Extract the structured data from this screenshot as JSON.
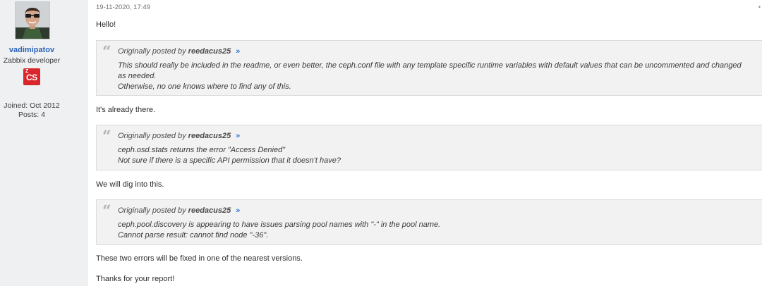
{
  "user": {
    "username": "vadimipatov",
    "title": "Zabbix developer",
    "badge_text": "CS",
    "badge_sup": "Z",
    "badge_color": "#d8262c",
    "joined": "Joined: Oct 2012",
    "posts": "Posts: 4"
  },
  "post": {
    "timestamp": "19-11-2020, 17:49",
    "greeting": "Hello!",
    "quotes": [
      {
        "prefix": "Originally posted by",
        "author": "reedacus25",
        "arrow": "»",
        "lines": [
          "This should really be included in the readme, or even better, the ceph.conf file with any template specific runtime variables with default values that can be uncommented and changed",
          "as needed.",
          "Otherwise, no one knows where to find any of this."
        ]
      },
      {
        "prefix": "Originally posted by",
        "author": "reedacus25",
        "arrow": "»",
        "lines": [
          "ceph.osd.stats returns the error \"Access Denied\"",
          "Not sure if there is a specific API permission that it doesn't have?"
        ]
      },
      {
        "prefix": "Originally posted by",
        "author": "reedacus25",
        "arrow": "»",
        "lines": [
          "ceph.pool.discovery is appearing to have issues parsing pool names with \"-\" in the pool name.",
          "Cannot parse result: cannot find node \"-36\"."
        ]
      }
    ],
    "replies": [
      "It's already there.",
      "We will dig into this.",
      "These two errors will be fixed in one of the nearest versions."
    ],
    "closing": "Thanks for your report!"
  },
  "colors": {
    "username": "#2a62b6",
    "quote_arrow": "#3b7dd8",
    "sidebar_bg": "#eef0f2",
    "quote_bg": "#f2f2f2"
  }
}
